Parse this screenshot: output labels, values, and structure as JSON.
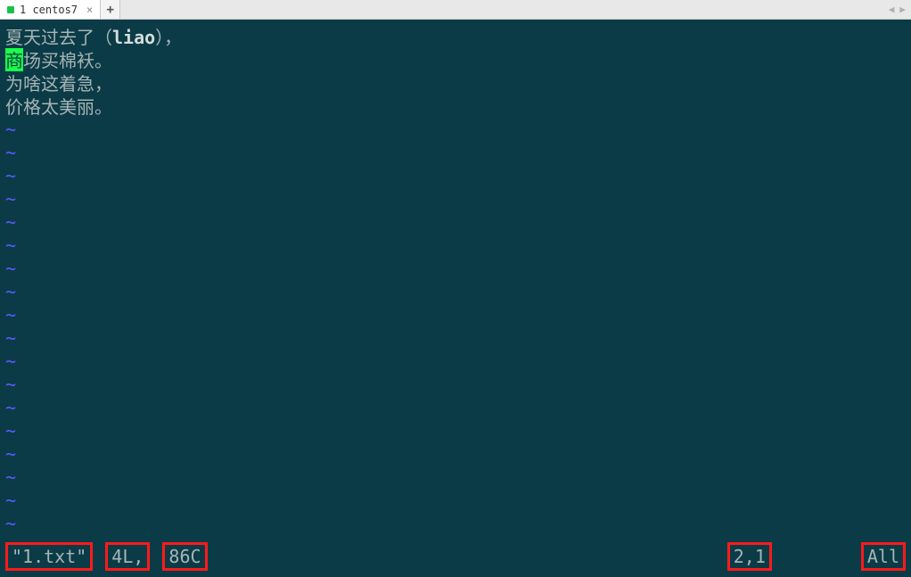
{
  "tabbar": {
    "tab_label": "1 centos7",
    "new_tab_label": "+",
    "arrow_left": "◀",
    "arrow_right": "▶"
  },
  "editor": {
    "lines": [
      {
        "pre": "",
        "cursor": "",
        "post_cjk": "夏天过去了（",
        "post_mono": "liao",
        "post_cjk2": "），"
      },
      {
        "pre": "",
        "cursor": "商",
        "post_cjk": "场买棉袄。",
        "post_mono": "",
        "post_cjk2": ""
      },
      {
        "pre": "",
        "cursor": "",
        "post_cjk": "为啥这着急，",
        "post_mono": "",
        "post_cjk2": ""
      },
      {
        "pre": "",
        "cursor": "",
        "post_cjk": "价格太美丽。",
        "post_mono": "",
        "post_cjk2": ""
      }
    ],
    "tilde": "~",
    "tilde_rows": 18
  },
  "status": {
    "filename": "\"1.txt\"",
    "linecount": "4L,",
    "charcount": "86C",
    "position": "2,1",
    "scroll": "All"
  }
}
